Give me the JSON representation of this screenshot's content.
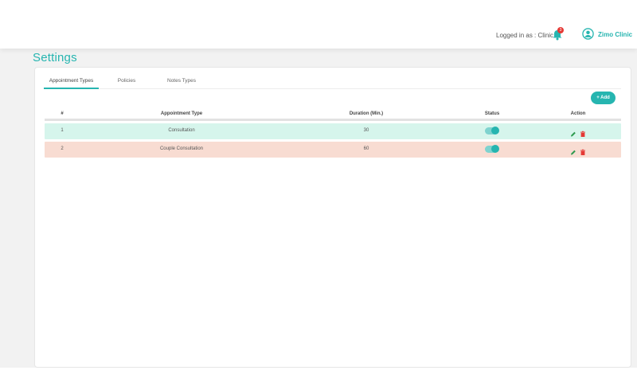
{
  "header": {
    "logged_in_text": "Logged in as : Clinic",
    "notification_count": "3",
    "user_name": "Zimo Clinic"
  },
  "page": {
    "title": "Settings"
  },
  "tabs": [
    {
      "label": "Appointment Types",
      "active": true
    },
    {
      "label": "Policies",
      "active": false
    },
    {
      "label": "Notes Types",
      "active": false
    }
  ],
  "add_button": {
    "label": "+ Add"
  },
  "table": {
    "columns": [
      "#",
      "Appointment Type",
      "Duration (Min.)",
      "Status",
      "Action"
    ],
    "rows": [
      {
        "index": "1",
        "type": "Consultation",
        "duration": "30",
        "status": "on",
        "row_color": "#d6f5ec"
      },
      {
        "index": "2",
        "type": "Couple Consultation",
        "duration": "60",
        "status": "on",
        "row_color": "#f8dcd2"
      }
    ]
  },
  "colors": {
    "accent": "#26b5b0",
    "delete": "#e53935",
    "edit": "#2e9a4f"
  }
}
